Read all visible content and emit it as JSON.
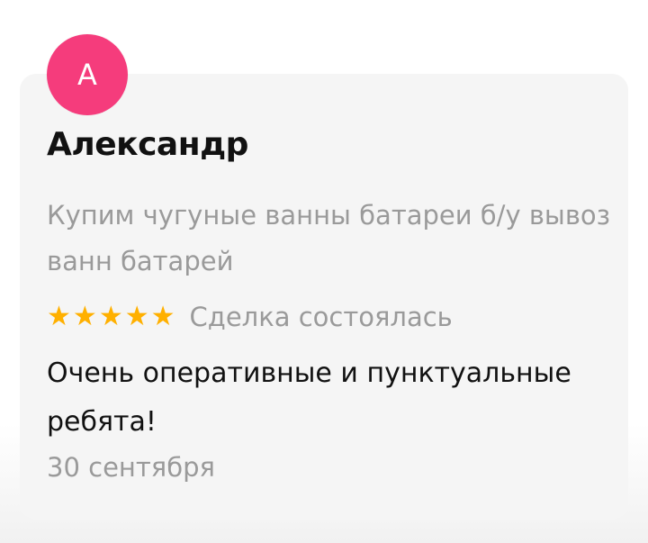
{
  "review": {
    "avatar_letter": "А",
    "avatar_color": "#f53c7c",
    "author_name": "Александр",
    "ad_title": "Купим чугуные ванны батареи б/у вывоз ванн батарей",
    "rating": 5,
    "rating_max": 5,
    "star_color": "#ffb000",
    "deal_status": "Сделка состоялась",
    "text": "Очень оперативные и пунктуальные ребята!",
    "date": "30 сентября"
  }
}
